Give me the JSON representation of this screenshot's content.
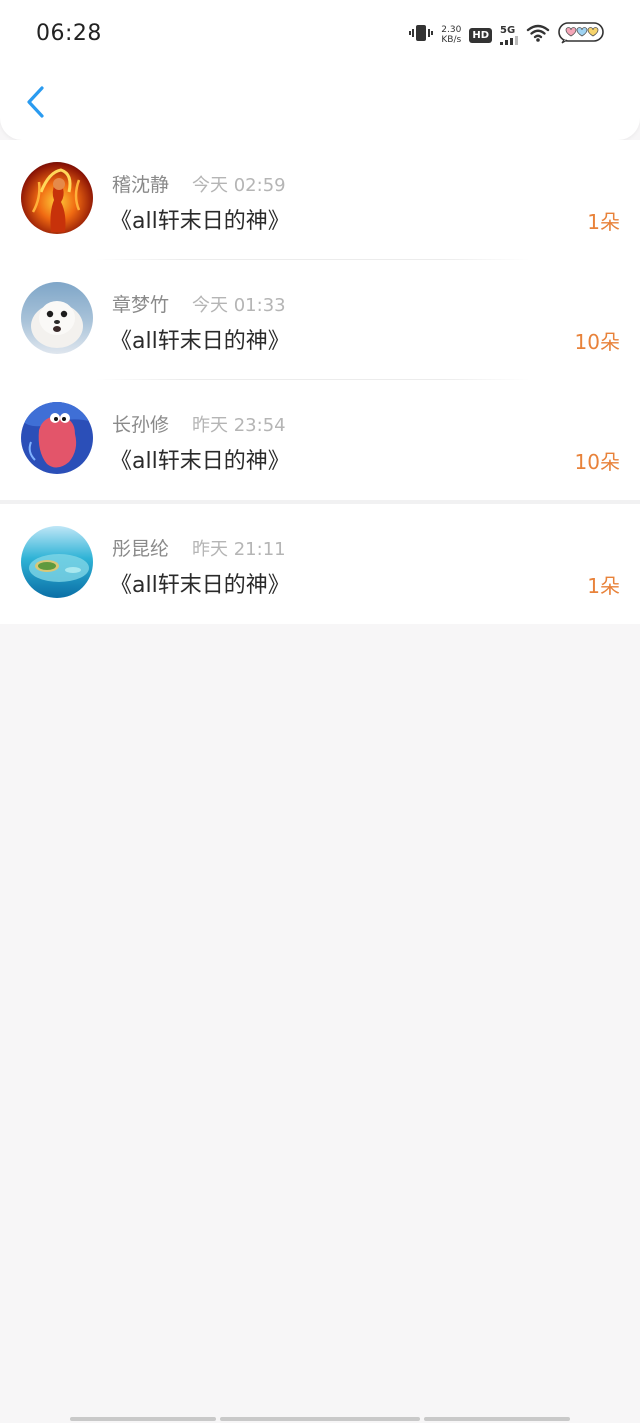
{
  "status_bar": {
    "time": "06:28",
    "net_speed_value": "2.30",
    "net_speed_unit": "KB/s",
    "hd_label": "HD",
    "network_label": "5G"
  },
  "header": {
    "back_icon": "chevron-left-icon"
  },
  "list": {
    "items": [
      {
        "name": "稽沈静",
        "time": "今天 02:59",
        "title": "《all轩末日的神》",
        "count": "1朵",
        "avatar": "fire-woman-avatar"
      },
      {
        "name": "章梦竹",
        "time": "今天 01:33",
        "title": "《all轩末日的神》",
        "count": "10朵",
        "avatar": "seal-avatar"
      },
      {
        "name": "长孙修",
        "time": "昨天 23:54",
        "title": "《all轩末日的神》",
        "count": "10朵",
        "avatar": "cartoon-crab-avatar"
      },
      {
        "name": "彤昆纶",
        "time": "昨天 21:11",
        "title": "《all轩末日的神》",
        "count": "1朵",
        "avatar": "island-avatar"
      }
    ]
  },
  "colors": {
    "accent_blue": "#2a9bf0",
    "count_orange": "#e8823a",
    "background": "#f7f6f7"
  }
}
